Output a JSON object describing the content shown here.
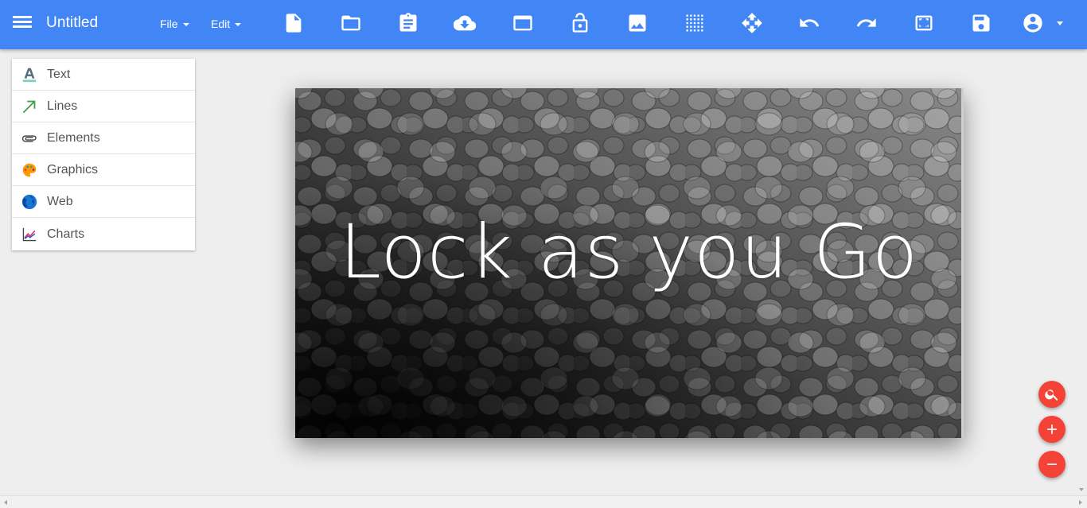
{
  "app": {
    "title": "Untitled",
    "accent_color": "#4285f4",
    "fab_color": "#f44336"
  },
  "menus": [
    {
      "label": "File"
    },
    {
      "label": "Edit"
    }
  ],
  "toolbar": {
    "icons": [
      "new-file-icon",
      "open-folder-icon",
      "clipboard-icon",
      "cloud-download-icon",
      "window-icon",
      "lock-open-icon",
      "image-icon",
      "grid-icon",
      "move-icon",
      "undo-icon",
      "redo-icon",
      "fullscreen-icon",
      "save-icon",
      "account-icon"
    ]
  },
  "sidebar": {
    "items": [
      {
        "label": "Text",
        "icon": "text-icon"
      },
      {
        "label": "Lines",
        "icon": "arrow-icon"
      },
      {
        "label": "Elements",
        "icon": "paperclip-icon"
      },
      {
        "label": "Graphics",
        "icon": "palette-icon"
      },
      {
        "label": "Web",
        "icon": "globe-icon"
      },
      {
        "label": "Charts",
        "icon": "line-chart-icon"
      }
    ]
  },
  "slide": {
    "text": "Lock as you Go"
  },
  "fabs": [
    "search-icon",
    "plus-icon",
    "minus-icon"
  ]
}
